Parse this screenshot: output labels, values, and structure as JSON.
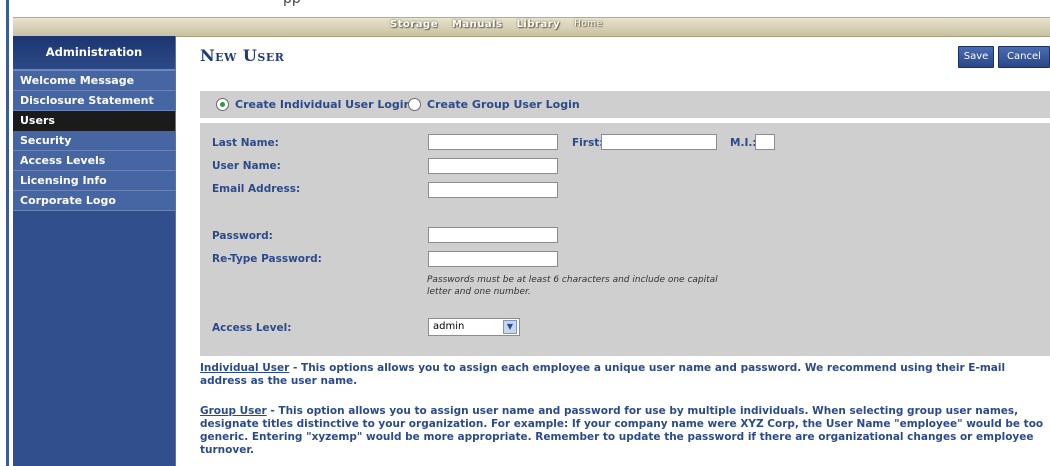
{
  "top_cutoff_text": "pp",
  "nav": {
    "items": [
      "Storage",
      "Manuals",
      "Library",
      "Home"
    ]
  },
  "sidebar": {
    "heading": "Administration",
    "items": [
      {
        "label": "Welcome Message",
        "active": false
      },
      {
        "label": "Disclosure Statement",
        "active": false
      },
      {
        "label": "Users",
        "active": true
      },
      {
        "label": "Security",
        "active": false
      },
      {
        "label": "Access Levels",
        "active": false
      },
      {
        "label": "Licensing Info",
        "active": false
      },
      {
        "label": "Corporate Logo",
        "active": false
      }
    ]
  },
  "page": {
    "title": "New User",
    "save_label": "Save",
    "cancel_label": "Cancel"
  },
  "login_options": {
    "individual": "Create Individual User Login",
    "group": "Create Group User Login",
    "selected": "individual"
  },
  "form": {
    "last_name_label": "Last Name:",
    "first_label": "First:",
    "mi_label": "M.I.:",
    "user_name_label": "User Name:",
    "email_label": "Email Address:",
    "password_label": "Password:",
    "retype_password_label": "Re-Type Password:",
    "password_hint": "Passwords must be at least 6 characters and include one capital letter and one number.",
    "access_level_label": "Access Level:",
    "access_level_value": "admin"
  },
  "info": {
    "individual_term": "Individual User",
    "individual_text": " - This options allows you to assign each employee a unique user name and password. We recommend using their E-mail address as the user name.",
    "group_term": "Group User",
    "group_text": " - This option allows you to assign user name and password for use by multiple individuals. When selecting group user names, designate titles distinctive to your organization. For example: If your company name were XYZ Corp, the User Name \"employee\" would be too generic. Entering \"xyzemp\" would be more appropriate. Remember to update the password if there are organizational changes or employee turnover."
  },
  "colors": {
    "sidebar": "#314f8c",
    "active_item": "#1b1b1b",
    "label_blue": "#2b4a8a",
    "panel_gray": "#cfcfcf"
  }
}
